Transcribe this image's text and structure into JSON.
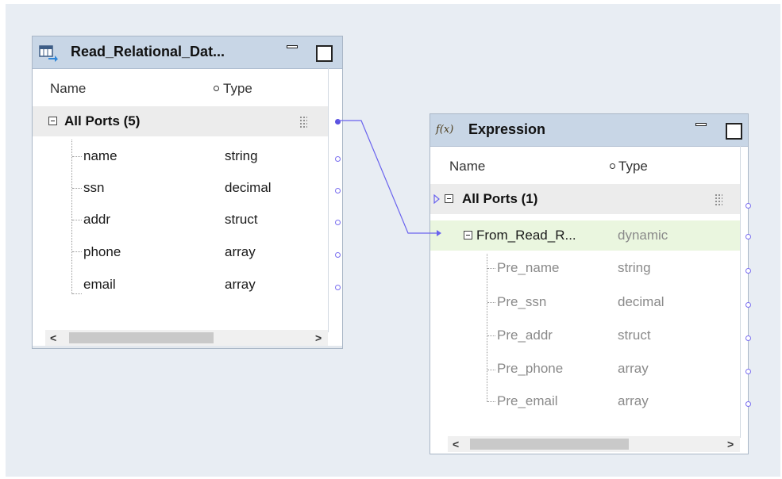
{
  "canvas": {
    "background": "#e8edf3"
  },
  "read_node": {
    "title": "Read_Relational_Dat...",
    "icon": "table-source-icon",
    "columns": {
      "name": "Name",
      "type": "Type"
    },
    "group": {
      "label": "All Ports (5)"
    },
    "ports": [
      {
        "name": "name",
        "type": "string"
      },
      {
        "name": "ssn",
        "type": "decimal"
      },
      {
        "name": "addr",
        "type": "struct"
      },
      {
        "name": "phone",
        "type": "array"
      },
      {
        "name": "email",
        "type": "array"
      }
    ],
    "scroll": {
      "left": "<",
      "right": ">"
    }
  },
  "expr_node": {
    "title": "Expression",
    "icon": "fx-icon",
    "icon_text": "f(x)",
    "columns": {
      "name": "Name",
      "type": "Type"
    },
    "group": {
      "label": "All Ports (1)"
    },
    "dynamic_port": {
      "name": "From_Read_R...",
      "type": "dynamic"
    },
    "ports": [
      {
        "name": "Pre_name",
        "type": "string"
      },
      {
        "name": "Pre_ssn",
        "type": "decimal"
      },
      {
        "name": "Pre_addr",
        "type": "struct"
      },
      {
        "name": "Pre_phone",
        "type": "array"
      },
      {
        "name": "Pre_email",
        "type": "array"
      }
    ],
    "scroll": {
      "left": "<",
      "right": ">"
    }
  },
  "colors": {
    "link": "#6a63ee",
    "header": "#c8d6e6",
    "dynamic_row": "#eaf6df"
  }
}
